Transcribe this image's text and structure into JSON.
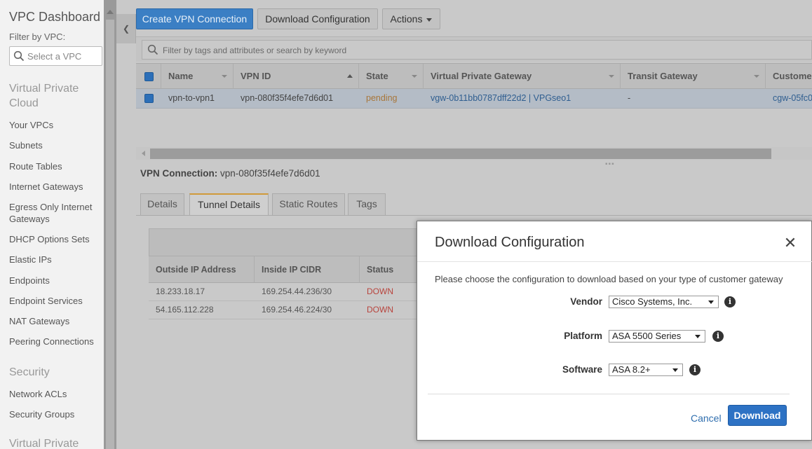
{
  "sidebar": {
    "title": "VPC Dashboard",
    "filter_label": "Filter by VPC:",
    "vpc_select_placeholder": "Select a VPC",
    "sections": [
      {
        "heading": "Virtual Private Cloud"
      },
      {
        "heading": "Security"
      },
      {
        "heading": "Virtual Private"
      }
    ],
    "items": [
      "Your VPCs",
      "Subnets",
      "Route Tables",
      "Internet Gateways",
      "Egress Only Internet Gateways",
      "DHCP Options Sets",
      "Elastic IPs",
      "Endpoints",
      "Endpoint Services",
      "NAT Gateways",
      "Peering Connections",
      "Network ACLs",
      "Security Groups"
    ]
  },
  "toolbar": {
    "create_label": "Create VPN Connection",
    "download_label": "Download Configuration",
    "actions_label": "Actions"
  },
  "search": {
    "placeholder": "Filter by tags and attributes or search by keyword"
  },
  "table": {
    "columns": [
      "Name",
      "VPN ID",
      "State",
      "Virtual Private Gateway",
      "Transit Gateway",
      "Customer"
    ],
    "rows": [
      {
        "name": "vpn-to-vpn1",
        "vpn_id": "vpn-080f35f4efe7d6d01",
        "state": "pending",
        "vgw": "vgw-0b11bb0787dff22d2 | VPGseo1",
        "transit": "-",
        "customer": "cgw-05fc0"
      }
    ]
  },
  "details": {
    "label": "VPN Connection:",
    "value": "vpn-080f35f4efe7d6d01",
    "tabs": [
      "Details",
      "Tunnel Details",
      "Static Routes",
      "Tags"
    ],
    "active_tab": "Tunnel Details"
  },
  "tunnels": {
    "columns": [
      "Outside IP Address",
      "Inside IP CIDR",
      "Status"
    ],
    "rows": [
      {
        "outside_ip": "18.233.18.17",
        "inside_cidr": "169.254.44.236/30",
        "status": "DOWN"
      },
      {
        "outside_ip": "54.165.112.228",
        "inside_cidr": "169.254.46.224/30",
        "status": "DOWN"
      }
    ]
  },
  "modal": {
    "title": "Download Configuration",
    "description": "Please choose the configuration to download based on your type of customer gateway",
    "fields": [
      {
        "label": "Vendor",
        "value": "Cisco Systems, Inc."
      },
      {
        "label": "Platform",
        "value": "ASA 5500 Series"
      },
      {
        "label": "Software",
        "value": "ASA 8.2+"
      }
    ],
    "cancel_label": "Cancel",
    "download_label": "Download"
  },
  "colors": {
    "primary_button": "#2d72c4",
    "selected_tab_accent": "#d09a3a",
    "status_down": "#b8443d",
    "state_pending": "#a8763a",
    "link": "#2f6eae"
  }
}
